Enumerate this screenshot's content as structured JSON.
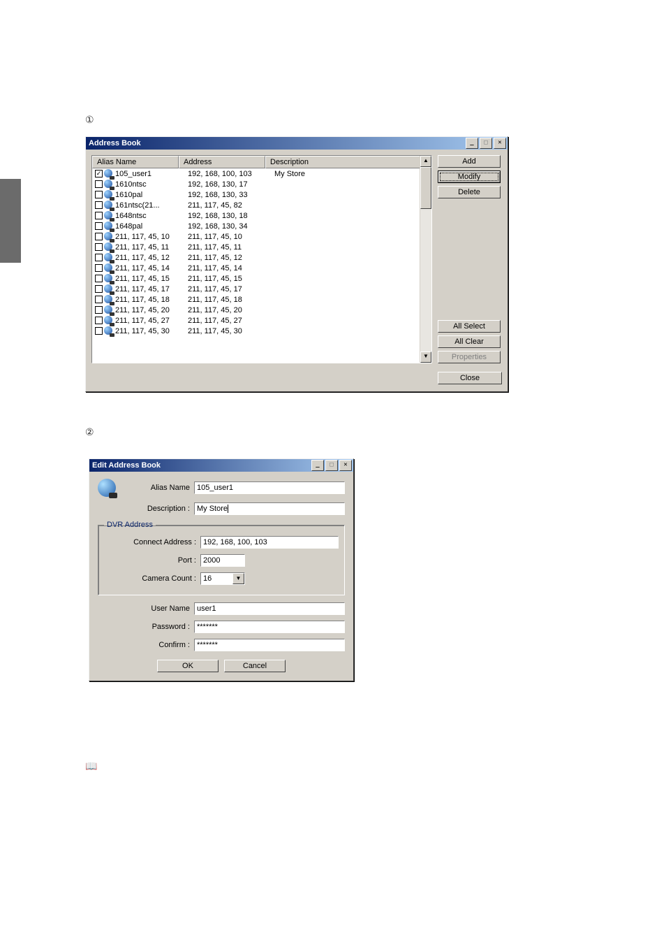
{
  "step_markers": {
    "one": "①",
    "two": "②",
    "book": "📖"
  },
  "addressbook": {
    "title": "Address Book",
    "columns": {
      "alias": "Alias Name",
      "address": "Address",
      "description": "Description"
    },
    "buttons": {
      "add": "Add",
      "modify": "Modify",
      "delete": "Delete",
      "all_select": "All Select",
      "all_clear": "All Clear",
      "properties": "Properties",
      "close": "Close"
    },
    "rows": [
      {
        "checked": true,
        "alias": "105_user1",
        "address": "192, 168, 100, 103",
        "description": "My Store"
      },
      {
        "checked": false,
        "alias": "1610ntsc",
        "address": "192, 168, 130, 17",
        "description": ""
      },
      {
        "checked": false,
        "alias": "1610pal",
        "address": "192, 168, 130, 33",
        "description": ""
      },
      {
        "checked": false,
        "alias": "161ntsc(21...",
        "address": "211, 117, 45, 82",
        "description": ""
      },
      {
        "checked": false,
        "alias": "1648ntsc",
        "address": "192, 168, 130, 18",
        "description": ""
      },
      {
        "checked": false,
        "alias": "1648pal",
        "address": "192, 168, 130, 34",
        "description": ""
      },
      {
        "checked": false,
        "alias": "211, 117, 45, 10",
        "address": "211, 117, 45, 10",
        "description": ""
      },
      {
        "checked": false,
        "alias": "211, 117, 45, 11",
        "address": "211, 117, 45, 11",
        "description": ""
      },
      {
        "checked": false,
        "alias": "211, 117, 45, 12",
        "address": "211, 117, 45, 12",
        "description": ""
      },
      {
        "checked": false,
        "alias": "211, 117, 45, 14",
        "address": "211, 117, 45, 14",
        "description": ""
      },
      {
        "checked": false,
        "alias": "211, 117, 45, 15",
        "address": "211, 117, 45, 15",
        "description": ""
      },
      {
        "checked": false,
        "alias": "211, 117, 45, 17",
        "address": "211, 117, 45, 17",
        "description": ""
      },
      {
        "checked": false,
        "alias": "211, 117, 45, 18",
        "address": "211, 117, 45, 18",
        "description": ""
      },
      {
        "checked": false,
        "alias": "211, 117, 45, 20",
        "address": "211, 117, 45, 20",
        "description": ""
      },
      {
        "checked": false,
        "alias": "211, 117, 45, 27",
        "address": "211, 117, 45, 27",
        "description": ""
      },
      {
        "checked": false,
        "alias": "211, 117, 45, 30",
        "address": "211, 117, 45, 30",
        "description": ""
      }
    ]
  },
  "editdialog": {
    "title": "Edit Address Book",
    "labels": {
      "alias": "Alias Name",
      "description": "Description :",
      "group": "DVR Address",
      "connect": "Connect Address :",
      "port": "Port :",
      "camera": "Camera Count :",
      "user": "User Name",
      "password": "Password :",
      "confirm": "Confirm :"
    },
    "values": {
      "alias": "105_user1",
      "description": "My Store",
      "connect": "192, 168, 100, 103",
      "port": "2000",
      "camera": "16",
      "user": "user1",
      "password": "*******",
      "confirm": "*******"
    },
    "buttons": {
      "ok": "OK",
      "cancel": "Cancel"
    }
  }
}
